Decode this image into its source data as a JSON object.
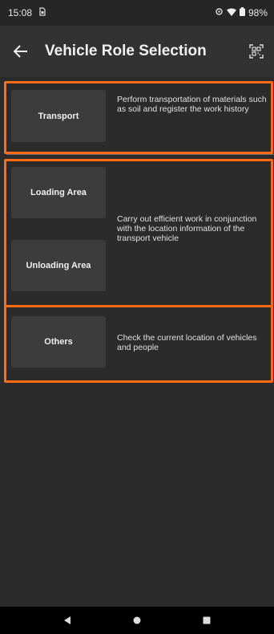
{
  "status_bar": {
    "time": "15:08",
    "battery": "98%"
  },
  "app_bar": {
    "title": "Vehicle Role Selection"
  },
  "roles": {
    "transport": {
      "label": "Transport",
      "description": "Perform transportation of materials such as soil and register the work history"
    },
    "loading_area": {
      "label": "Loading Area"
    },
    "unloading_area": {
      "label": "Unloading Area"
    },
    "area_description": "Carry out efficient work in conjunction with the location information of the transport vehicle",
    "others": {
      "label": "Others",
      "description": "Check the current location of vehicles and people"
    }
  },
  "colors": {
    "accent": "#ff6a13",
    "background": "#2b2b2b",
    "button": "#3c3c3c"
  },
  "icons": [
    "sim-icon",
    "location-icon",
    "wifi-icon",
    "battery-icon",
    "back-arrow-icon",
    "qr-scan-icon",
    "nav-back-icon",
    "nav-home-icon",
    "nav-recents-icon"
  ]
}
